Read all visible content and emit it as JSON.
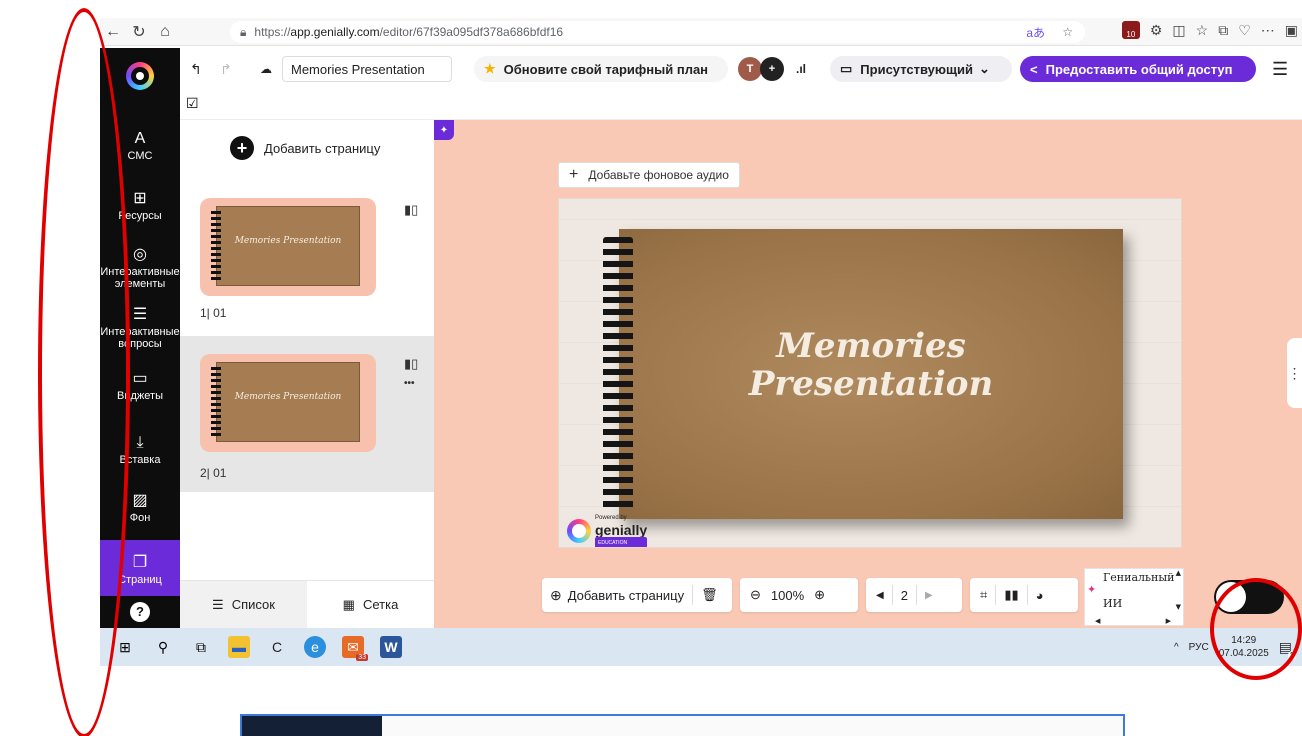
{
  "browser": {
    "url_prefix": "https://",
    "url_host": "app.genially.com",
    "url_path": "/editor/67f39a095df378a686bfdf16",
    "ext_badge": "10"
  },
  "header": {
    "presentation_title": "Memories Presentation",
    "upgrade_label": "Обновите свой тарифный план",
    "avatar_initial": "T",
    "present_label": "Присутствующий",
    "share_label": "Предоставить общий доступ"
  },
  "sidebar": {
    "items": [
      {
        "label": "СМС",
        "icon": "A"
      },
      {
        "label": "Ресурсы",
        "icon": "⊞"
      },
      {
        "label": "Интерактивные элементы",
        "icon": "◎"
      },
      {
        "label": "Интерактивные вопросы",
        "icon": "☰"
      },
      {
        "label": "Виджеты",
        "icon": "▭"
      },
      {
        "label": "Вставка",
        "icon": "⤓"
      },
      {
        "label": "Фон",
        "icon": "▨"
      },
      {
        "label": "Страниц",
        "icon": "❐"
      }
    ],
    "help": "?"
  },
  "pages_panel": {
    "add_page_label": "Добавить страницу",
    "pages": [
      {
        "number": "1| 01",
        "thumb_title": "Memories Presentation"
      },
      {
        "number": "2| 01",
        "thumb_title": "Memories Presentation"
      }
    ],
    "more": "•••",
    "tab_list": "Список",
    "tab_grid": "Сетка"
  },
  "canvas": {
    "audio_label": "Добавьте фоновое аудио",
    "slide_title_line1": "Memories",
    "slide_title_line2": "Presentation",
    "powered_small": "Powered by",
    "powered_brand": "genially",
    "powered_edu": "EDUCATION"
  },
  "bottom_toolbar": {
    "add_page_label": "Добавить страницу",
    "zoom": "100%",
    "current_page": "2",
    "ai_label_line1": "Гениальный",
    "ai_label_line2": "ИИ"
  },
  "taskbar": {
    "language": "РУС",
    "time": "14:29",
    "date": "07.04.2025",
    "notif_count": "1",
    "mail_badge": "33"
  },
  "colors": {
    "accent": "#6c2bd9",
    "canvas_bg": "#f9c9b6",
    "annotation": "#e00000"
  }
}
